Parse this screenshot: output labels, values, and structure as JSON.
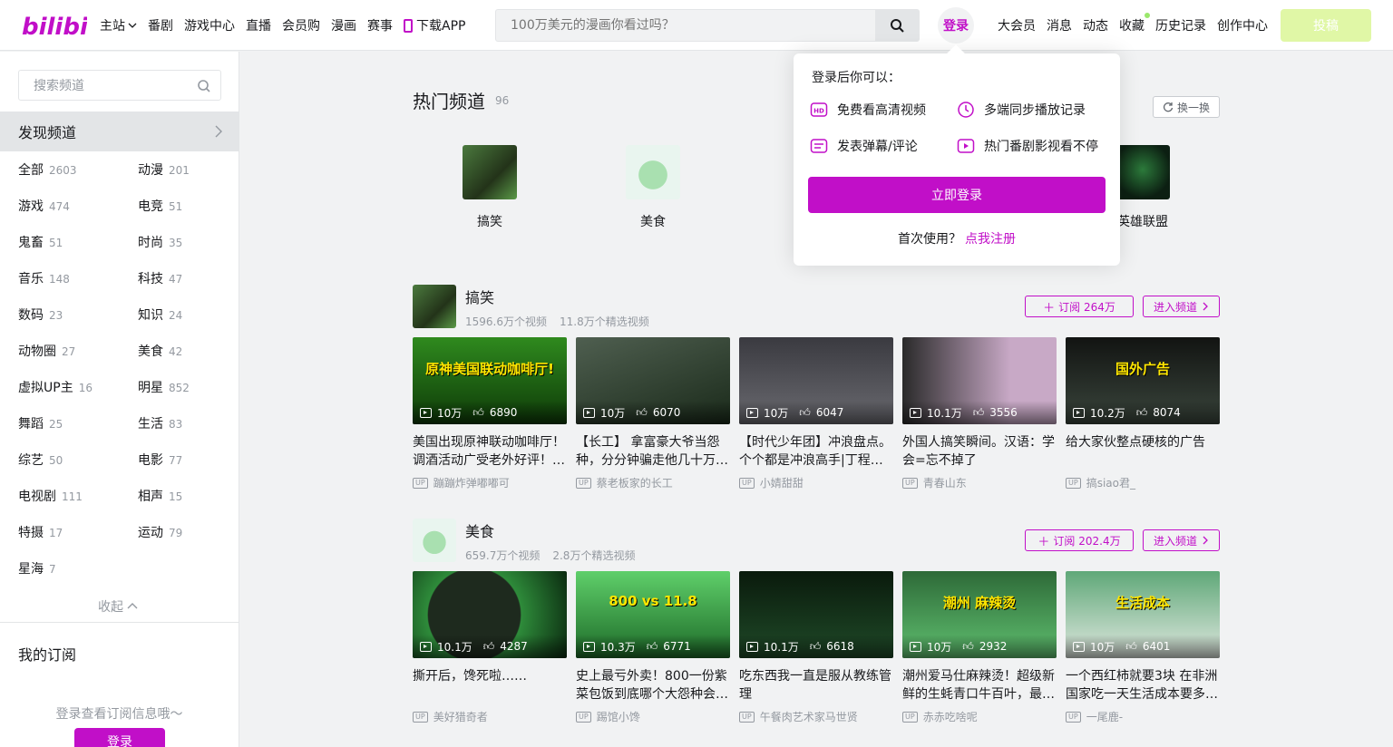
{
  "header": {
    "logo_text": "bilibili",
    "nav": [
      "主站",
      "番剧",
      "游戏中心",
      "直播",
      "会员购",
      "漫画",
      "赛事",
      "下载APP"
    ],
    "search_placeholder": "100万美元的漫画你看过吗？",
    "login": "登录",
    "right_nav": [
      "大会员",
      "消息",
      "动态",
      "收藏",
      "历史记录",
      "创作中心"
    ],
    "upload": "投稿",
    "colors": {
      "brand": "#c10fc8",
      "upload_bg": "#e0f7a6"
    }
  },
  "sidebar": {
    "search_placeholder": "搜索频道",
    "discover": "发现频道",
    "categories": [
      {
        "name": "全部",
        "count": "2603"
      },
      {
        "name": "动漫",
        "count": "201"
      },
      {
        "name": "游戏",
        "count": "474"
      },
      {
        "name": "电竞",
        "count": "51"
      },
      {
        "name": "鬼畜",
        "count": "51"
      },
      {
        "name": "时尚",
        "count": "35"
      },
      {
        "name": "音乐",
        "count": "148"
      },
      {
        "name": "科技",
        "count": "47"
      },
      {
        "name": "数码",
        "count": "23"
      },
      {
        "name": "知识",
        "count": "24"
      },
      {
        "name": "动物圈",
        "count": "27"
      },
      {
        "name": "美食",
        "count": "42"
      },
      {
        "name": "虚拟UP主",
        "count": "16"
      },
      {
        "name": "明星",
        "count": "852"
      },
      {
        "name": "舞蹈",
        "count": "25"
      },
      {
        "name": "生活",
        "count": "83"
      },
      {
        "name": "综艺",
        "count": "50"
      },
      {
        "name": "电影",
        "count": "77"
      },
      {
        "name": "电视剧",
        "count": "111"
      },
      {
        "name": "相声",
        "count": "15"
      },
      {
        "name": "特摄",
        "count": "17"
      },
      {
        "name": "运动",
        "count": "79"
      },
      {
        "name": "星海",
        "count": "7"
      }
    ],
    "collapse": "收起",
    "my_sub": "我的订阅",
    "sub_hint": "登录查看订阅信息哦～",
    "login_btn": "登录"
  },
  "hot": {
    "title": "热门频道",
    "count": "96",
    "swap": "换一换",
    "channels": [
      "搞笑",
      "美食",
      "英雄联盟"
    ]
  },
  "sections": [
    {
      "name": "搞笑",
      "videos_count": "1596.6万个视频",
      "featured_count": "11.8万个精选视频",
      "subscribe": "订阅 264万",
      "enter": "进入频道",
      "videos": [
        {
          "views": "10万",
          "likes": "6890",
          "title": "美国出现原神联动咖啡厅！调酒活动广受老外好评！…",
          "up": "蹦蹦炸弹嘟嘟可",
          "overlay": "原神美国联动咖啡厅!"
        },
        {
          "views": "10万",
          "likes": "6070",
          "title": "【长工】 拿富豪大爷当怨种，分分钟骗走他几十万…",
          "up": "蔡老板家的长工",
          "overlay": ""
        },
        {
          "views": "10万",
          "likes": "6047",
          "title": "【时代少年团】冲浪盘点。个个都是冲浪高手|丁程…",
          "up": "小婧甜甜",
          "overlay": ""
        },
        {
          "views": "10.1万",
          "likes": "3556",
          "title": "外国人搞笑瞬间。汉语：学会=忘不掉了",
          "up": "青春山东",
          "overlay": ""
        },
        {
          "views": "10.2万",
          "likes": "8074",
          "title": "给大家伙整点硬核的广告",
          "up": "搞siao君_",
          "overlay": "国外广告"
        }
      ]
    },
    {
      "name": "美食",
      "videos_count": "659.7万个视频",
      "featured_count": "2.8万个精选视频",
      "subscribe": "订阅 202.4万",
      "enter": "进入频道",
      "videos": [
        {
          "views": "10.1万",
          "likes": "4287",
          "title": "撕开后，馋死啦……",
          "up": "美好猎奇者",
          "overlay": ""
        },
        {
          "views": "10.3万",
          "likes": "6771",
          "title": "史上最亏外卖！800一份紫菜包饭到底哪个大怨种会…",
          "up": "踢馆小馋",
          "overlay": "800 vs 11.8"
        },
        {
          "views": "10.1万",
          "likes": "6618",
          "title": "吃东西我一直是服从教练管理",
          "up": "午餐肉艺术家马世贤",
          "overlay": ""
        },
        {
          "views": "10万",
          "likes": "2932",
          "title": "潮州爱马仕麻辣烫！超级新鲜的生蚝青口牛百叶，最…",
          "up": "赤赤吃啥呢",
          "overlay": "潮州  麻辣烫"
        },
        {
          "views": "10万",
          "likes": "6401",
          "title": "一个西红柿就要3块 在非洲国家吃一天生活成本要多…",
          "up": "一尾鹿-",
          "overlay": "生活成本"
        }
      ]
    }
  ],
  "popover": {
    "title": "登录后你可以：",
    "features": [
      "免费看高清视频",
      "多端同步播放记录",
      "发表弹幕/评论",
      "热门番剧影视看不停"
    ],
    "login_btn": "立即登录",
    "register_prompt": "首次使用？",
    "register_link": "点我注册"
  }
}
